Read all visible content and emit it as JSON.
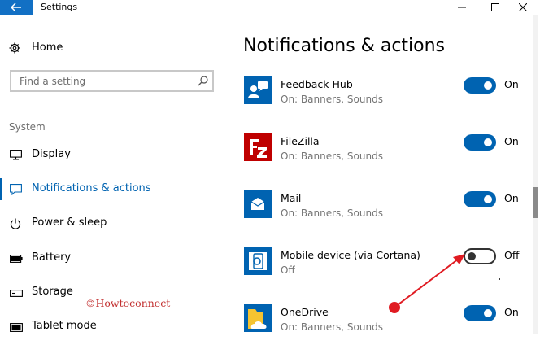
{
  "window": {
    "title": "Settings"
  },
  "sidebar": {
    "home_label": "Home",
    "search_placeholder": "Find a setting",
    "group_label": "System",
    "items": [
      {
        "label": "Display",
        "icon": "monitor-icon"
      },
      {
        "label": "Notifications & actions",
        "icon": "notification-icon",
        "active": true
      },
      {
        "label": "Power & sleep",
        "icon": "power-icon"
      },
      {
        "label": "Battery",
        "icon": "battery-icon"
      },
      {
        "label": "Storage",
        "icon": "storage-icon"
      },
      {
        "label": "Tablet mode",
        "icon": "tablet-icon"
      }
    ]
  },
  "main": {
    "title": "Notifications & actions",
    "apps": [
      {
        "name": "Feedback Hub",
        "status": "On: Banners, Sounds",
        "toggle": "On",
        "on": true,
        "icon": "feedback-hub-icon",
        "icon_color": "#0063b1"
      },
      {
        "name": "FileZilla",
        "status": "On: Banners, Sounds",
        "toggle": "On",
        "on": true,
        "icon": "filezilla-icon",
        "icon_color": "#bf0000"
      },
      {
        "name": "Mail",
        "status": "On: Banners, Sounds",
        "toggle": "On",
        "on": true,
        "icon": "mail-icon",
        "icon_color": "#0063b1"
      },
      {
        "name": "Mobile device (via Cortana)",
        "status": "Off",
        "toggle": "Off",
        "on": false,
        "icon": "mobile-cortana-icon",
        "icon_color": "#0063b1"
      },
      {
        "name": "OneDrive",
        "status": "On: Banners, Sounds",
        "toggle": "On",
        "on": true,
        "icon": "onedrive-icon",
        "icon_color": "#0063b1"
      }
    ]
  },
  "watermark": "©Howtoconnect",
  "colors": {
    "accent": "#0063b1",
    "back_button": "#1270c4",
    "annotation": "#e01b22"
  }
}
